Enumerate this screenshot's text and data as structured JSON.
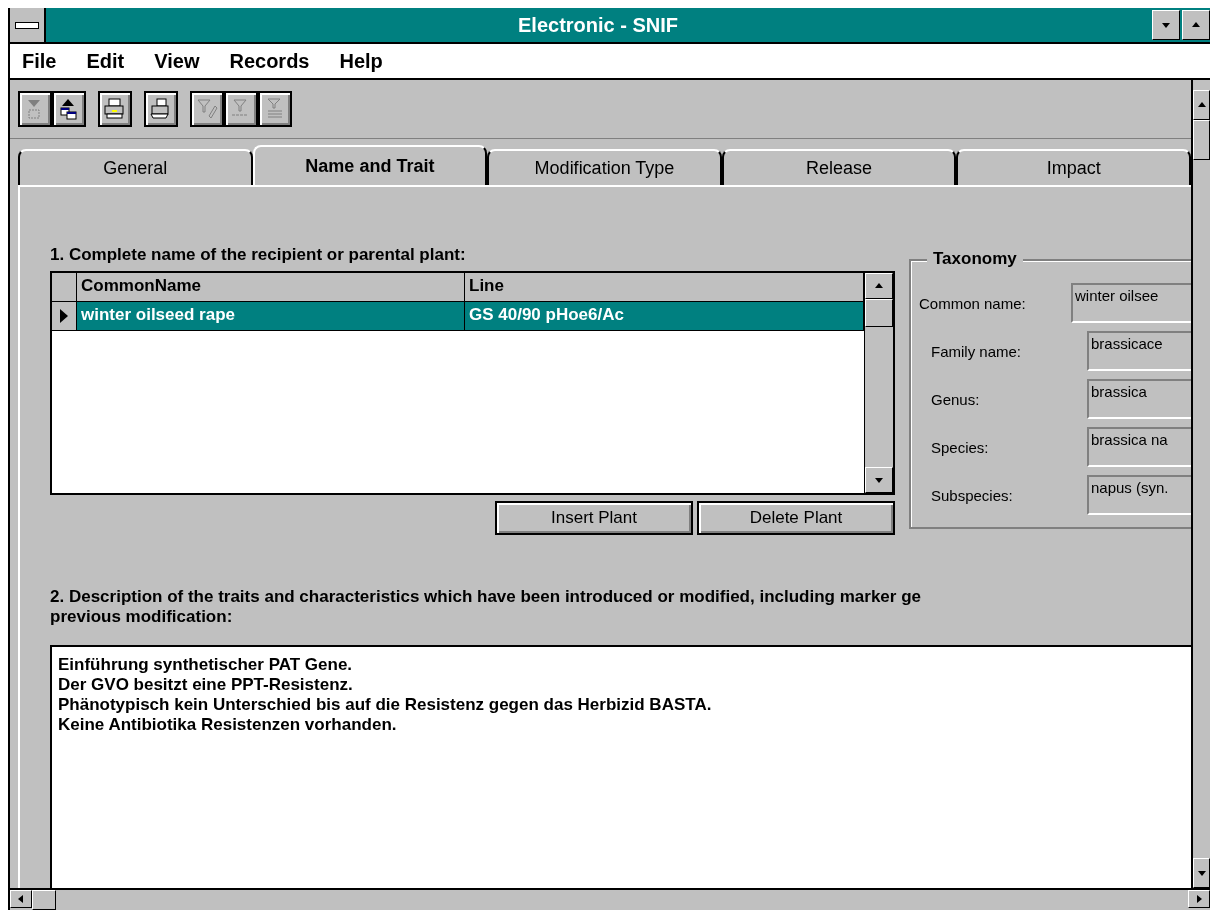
{
  "window": {
    "title": "Electronic - SNIF"
  },
  "menu": [
    "File",
    "Edit",
    "View",
    "Records",
    "Help"
  ],
  "toolbar": [
    {
      "kind": "insert",
      "disabled": true
    },
    {
      "kind": "copy",
      "disabled": false
    },
    {
      "kind": "print",
      "disabled": false
    },
    {
      "kind": "print-setup",
      "disabled": false
    },
    {
      "kind": "filter-edit",
      "disabled": true
    },
    {
      "kind": "filter",
      "disabled": true
    },
    {
      "kind": "filter-list",
      "disabled": true
    }
  ],
  "tabs": [
    {
      "label": "General",
      "selected": false
    },
    {
      "label": "Name and Trait",
      "selected": true
    },
    {
      "label": "Modification Type",
      "selected": false
    },
    {
      "label": "Release",
      "selected": false
    },
    {
      "label": "Impact",
      "selected": false
    }
  ],
  "section_1": {
    "label": "1. Complete name of the recipient or parental plant:",
    "table": {
      "columns": [
        "CommonName",
        "Line"
      ],
      "rows": [
        {
          "cells": [
            "winter oilseed rape",
            "GS 40/90 pHoe6/Ac"
          ],
          "selected": true
        }
      ]
    },
    "buttons": [
      "Insert Plant",
      "Delete Plant"
    ]
  },
  "taxonomy": {
    "title": "Taxonomy",
    "fields": [
      {
        "label": "Common name:",
        "value": "winter oilsee"
      },
      {
        "label": "Family name:",
        "value": "brassicace"
      },
      {
        "label": "Genus:",
        "value": "brassica"
      },
      {
        "label": "Species:",
        "value": "brassica na"
      },
      {
        "label": "Subspecies:",
        "value": "napus (syn."
      }
    ]
  },
  "section_2": {
    "label_lines": [
      "2. Description of the traits and characteristics which have been introduced or modified, including marker ge",
      "previous modification:"
    ],
    "text_lines": [
      "Einführung synthetischer PAT Gene.",
      "Der GVO besitzt eine PPT-Resistenz.",
      "Phänotypisch kein Unterschied bis auf die Resistenz gegen das Herbizid BASTA.",
      "Keine Antibiotika Resistenzen vorhanden."
    ]
  }
}
